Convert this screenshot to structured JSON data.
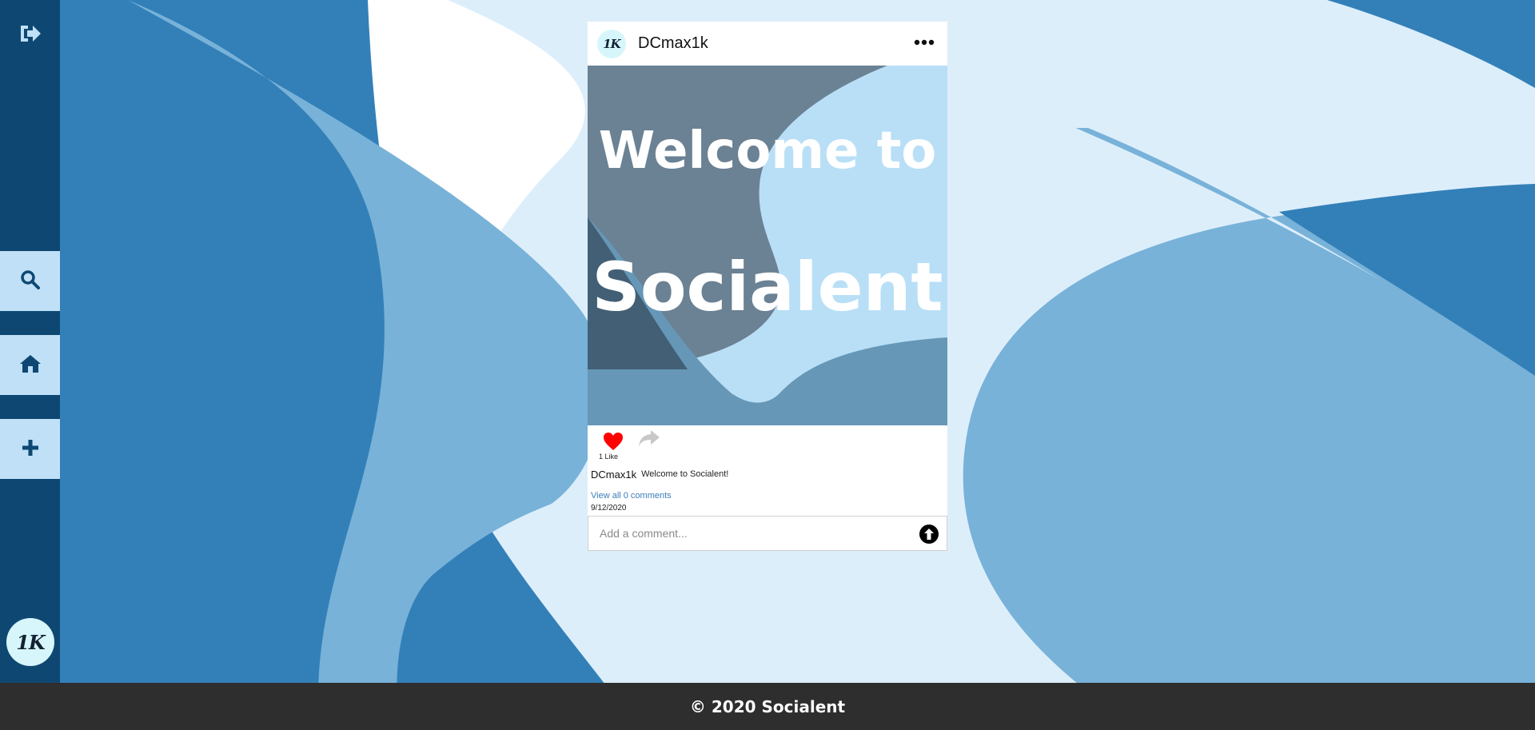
{
  "colors": {
    "sidebar": "#0e4872",
    "sidebar_button": "#bfe0f7",
    "footer": "#2e2e2e",
    "like": "#ff0000",
    "link": "#3a7db8"
  },
  "sidebar": {
    "logout_icon": "logout-icon",
    "items": [
      {
        "icon": "search-icon"
      },
      {
        "icon": "home-icon"
      },
      {
        "icon": "plus-icon"
      }
    ],
    "avatar_text": "1K"
  },
  "post": {
    "avatar_text": "1K",
    "username": "DCmax1k",
    "image_text": [
      "Welcome to",
      "Socialent"
    ],
    "like_count": "1 Like",
    "caption_user": "DCmax1k",
    "caption_text": "Welcome to Socialent!",
    "comments_link": "View all 0 comments",
    "date": "9/12/2020",
    "comment_placeholder": "Add a comment..."
  },
  "footer": {
    "text": "© 2020 Socialent"
  }
}
